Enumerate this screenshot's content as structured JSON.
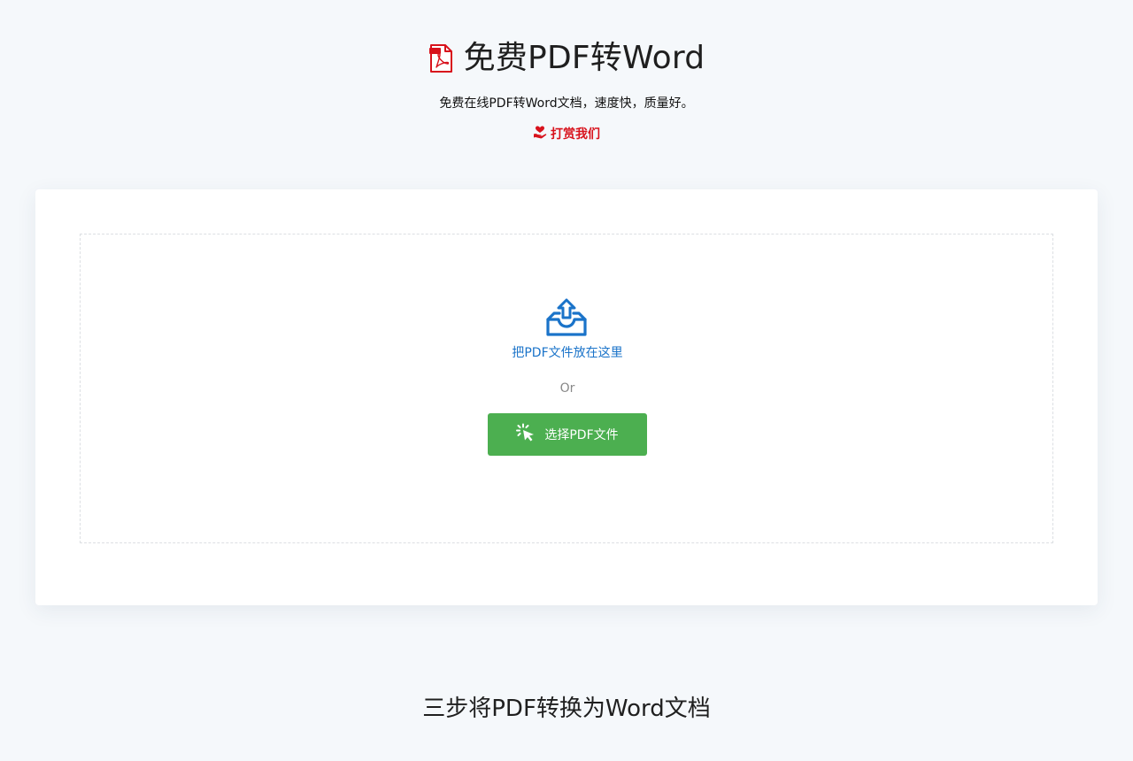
{
  "header": {
    "title": "免费PDF转Word",
    "subtitle": "免费在线PDF转Word文档，速度快，质量好。",
    "donate_label": "打赏我们",
    "icons": {
      "logo": "pdf-file-icon",
      "donate": "heart-hand-icon"
    }
  },
  "upload": {
    "drop_text": "把PDF文件放在这里",
    "or_text": "Or",
    "select_button_label": "选择PDF文件",
    "icons": {
      "drop": "upload-tray-icon",
      "button": "click-cursor-icon"
    }
  },
  "steps": {
    "title": "三步将PDF转换为Word文档"
  },
  "colors": {
    "background": "#f5f8fb",
    "brand_red": "#d8121c",
    "link_blue": "#1a73c9",
    "button_green": "#4caf50"
  }
}
